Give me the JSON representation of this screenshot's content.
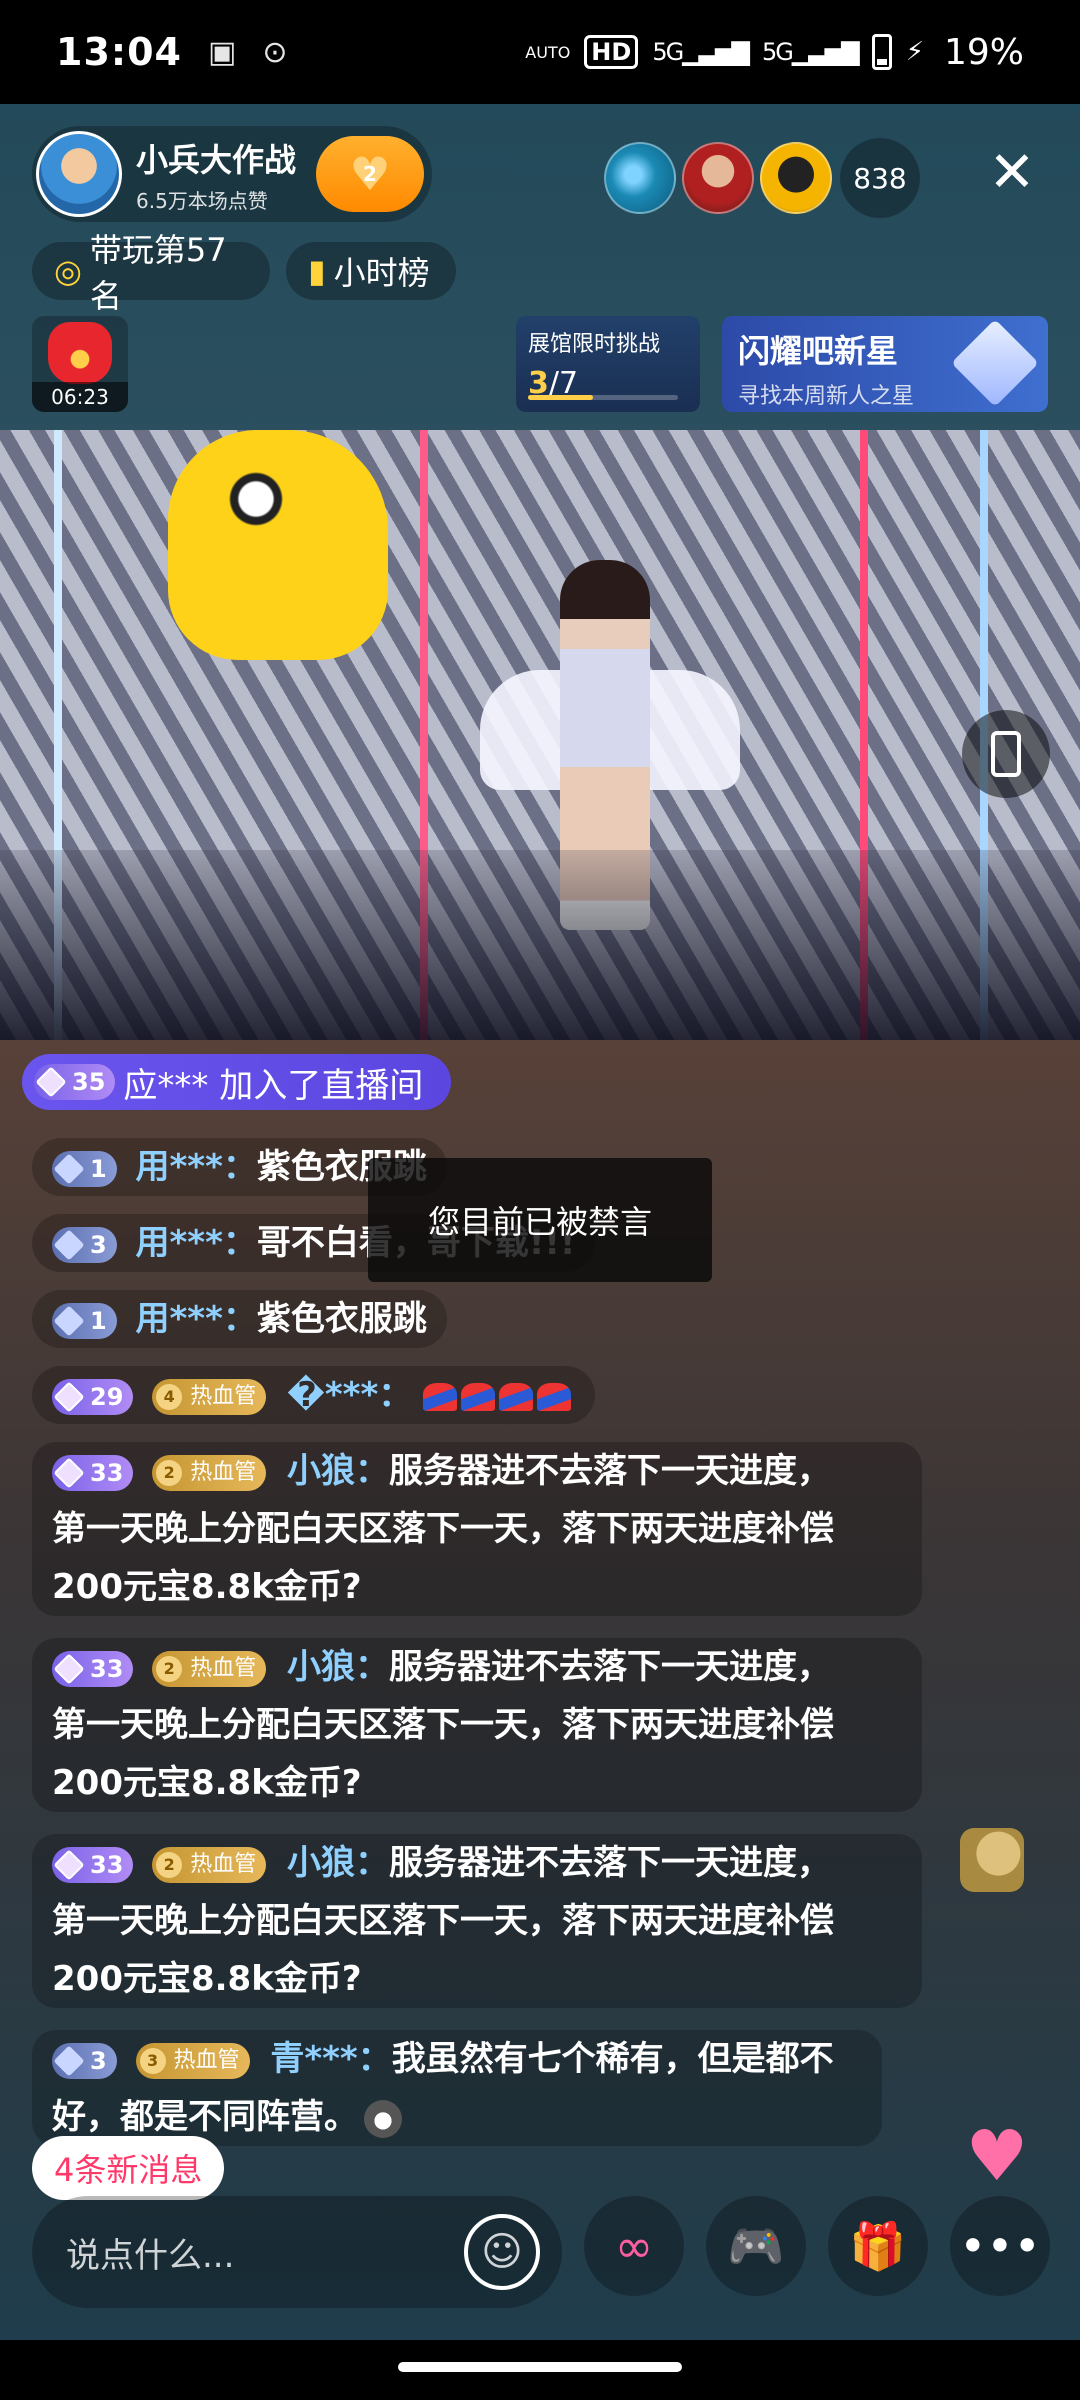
{
  "status_bar": {
    "time": "13:04",
    "battery": "19%",
    "hd": "HD",
    "net1": "5G",
    "net2": "5G",
    "auto": "AUTO"
  },
  "host": {
    "name": "小兵大作战",
    "likes": "6.5万本场点赞",
    "follow_level": "2"
  },
  "viewers": {
    "count": "838"
  },
  "chips": {
    "rank": "带玩第57名",
    "hourly": "小时榜"
  },
  "red_packet": {
    "timer": "06:23"
  },
  "challenge": {
    "title": "展馆限时挑战",
    "current": "3",
    "total": "/7",
    "progress": 0.43
  },
  "star_banner": {
    "title": "闪耀吧新星",
    "subtitle": "寻找本周新人之星"
  },
  "join": {
    "level": "35",
    "text": "应*** 加入了直播间"
  },
  "toast": "您目前已被禁言",
  "messages": [
    {
      "level": "1",
      "user": "用***：",
      "text": "紫色衣服跳"
    },
    {
      "level": "3",
      "user": "用***：",
      "text": "哥不白看，哥下载!!!"
    },
    {
      "level": "1",
      "user": "用***：",
      "text": "紫色衣服跳"
    },
    {
      "level": "29",
      "badge_num": "4",
      "badge": "热血管",
      "user": "�***："
    },
    {
      "level": "33",
      "badge_num": "2",
      "badge": "热血管",
      "user": "小狼：",
      "line1": "服务器进不去落下一天进度，",
      "line2": "第一天晚上分配白天区落下一天，落下两天进度补偿",
      "line3": "200元宝8.8k金币?"
    },
    {
      "level": "33",
      "badge_num": "2",
      "badge": "热血管",
      "user": "小狼：",
      "line1": "服务器进不去落下一天进度，",
      "line2": "第一天晚上分配白天区落下一天，落下两天进度补偿",
      "line3": "200元宝8.8k金币?"
    },
    {
      "level": "33",
      "badge_num": "2",
      "badge": "热血管",
      "user": "小狼：",
      "line1": "服务器进不去落下一天进度，",
      "line2": "第一天晚上分配白天区落下一天，落下两天进度补偿",
      "line3": "200元宝8.8k金币?"
    },
    {
      "level": "3",
      "badge_num": "3",
      "badge": "热血管",
      "user": "青***：",
      "line1": "我虽然有七个稀有，但是都不",
      "line2": "好，都是不同阵营。"
    }
  ],
  "new_messages": "4条新消息",
  "input": {
    "placeholder": "说点什么..."
  },
  "icons": [
    "close-icon",
    "gamepad-icon",
    "bar-chart-icon",
    "emoji-icon",
    "link-icon",
    "game-controller-icon",
    "gift-icon",
    "more-icon",
    "rotate-screen-icon"
  ]
}
